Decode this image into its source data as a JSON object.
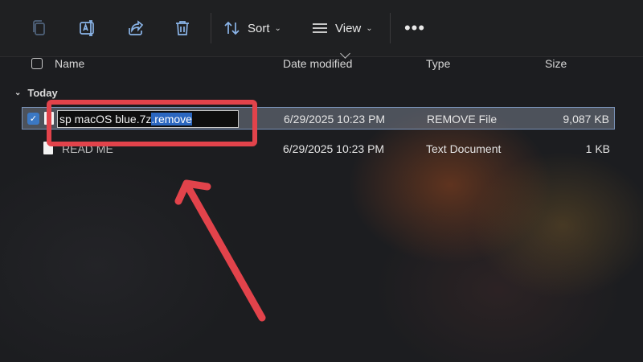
{
  "toolbar": {
    "buttons": [
      {
        "name": "copy-button",
        "icon": "copy-icon"
      },
      {
        "name": "rename-button",
        "icon": "rename-icon"
      },
      {
        "name": "share-button",
        "icon": "share-icon"
      },
      {
        "name": "delete-button",
        "icon": "trash-icon"
      }
    ],
    "sort_label": "Sort",
    "view_label": "View",
    "more_icon": "more-icon"
  },
  "columns": {
    "name": "Name",
    "date": "Date modified",
    "type": "Type",
    "size": "Size"
  },
  "group": {
    "label": "Today"
  },
  "files": [
    {
      "rename_prefix": "sp macOS blue.7z",
      "rename_selected": ".remove",
      "date": "6/29/2025 10:23 PM",
      "type": "REMOVE File",
      "size": "9,087 KB",
      "selected": true
    },
    {
      "name": "READ ME",
      "date": "6/29/2025 10:23 PM",
      "type": "Text Document",
      "size": "1 KB",
      "selected": false
    }
  ],
  "colors": {
    "annotation": "#e2434b",
    "selection": "#2b67c0",
    "accent_icon": "#8ab4e8"
  }
}
